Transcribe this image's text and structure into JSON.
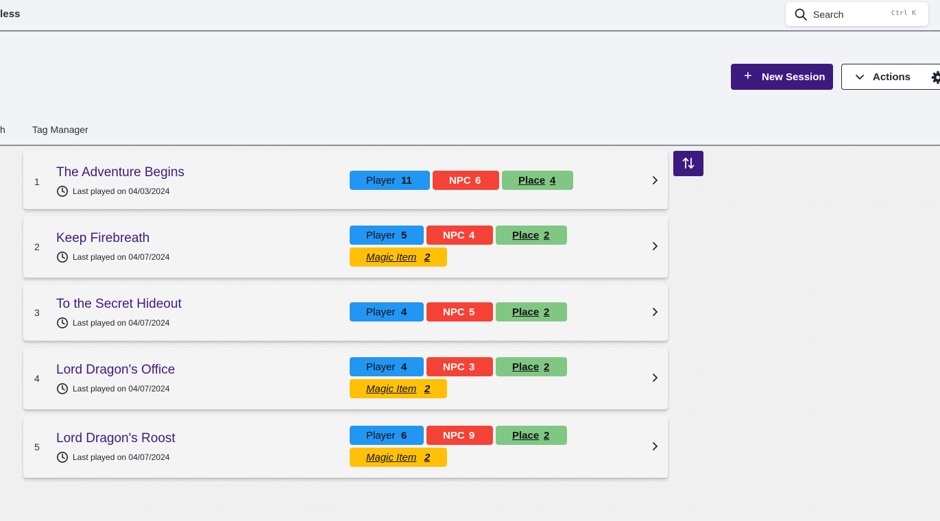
{
  "app": {
    "title_partial": "less"
  },
  "search": {
    "label": "Search",
    "shortcut": "Ctrl K",
    "icon": "search-icon"
  },
  "toolbar": {
    "new_session_label": "New Session",
    "new_session_icon": "plus-icon",
    "actions_label": "Actions",
    "actions_icon": "chevron-down-icon",
    "settings_icon": "gear-icon"
  },
  "tabs": {
    "partial_tab": "h",
    "tag_manager": "Tag Manager"
  },
  "sort_icon": "sort-arrows-icon",
  "sessions": [
    {
      "number": "1",
      "title": "The Adventure Begins",
      "last_played": "Last played on 04/03/2024",
      "tags": {
        "player": {
          "label": "Player",
          "count": "11"
        },
        "npc": {
          "label": "NPC",
          "count": "6"
        },
        "place": {
          "label": "Place",
          "count": "4"
        }
      }
    },
    {
      "number": "2",
      "title": "Keep Firebreath",
      "last_played": "Last played on 04/07/2024",
      "tags": {
        "player": {
          "label": "Player",
          "count": "5"
        },
        "npc": {
          "label": "NPC",
          "count": "4"
        },
        "place": {
          "label": "Place",
          "count": "2"
        },
        "magic": {
          "label": "Magic Item",
          "count": "2"
        }
      }
    },
    {
      "number": "3",
      "title": "To the Secret Hideout",
      "last_played": "Last played on 04/07/2024",
      "tags": {
        "player": {
          "label": "Player",
          "count": "4"
        },
        "npc": {
          "label": "NPC",
          "count": "5"
        },
        "place": {
          "label": "Place",
          "count": "2"
        }
      }
    },
    {
      "number": "4",
      "title": "Lord Dragon's Office",
      "last_played": "Last played on 04/07/2024",
      "tags": {
        "player": {
          "label": "Player",
          "count": "4"
        },
        "npc": {
          "label": "NPC",
          "count": "3"
        },
        "place": {
          "label": "Place",
          "count": "2"
        },
        "magic": {
          "label": "Magic Item",
          "count": "2"
        }
      }
    },
    {
      "number": "5",
      "title": "Lord Dragon's Roost",
      "last_played": "Last played on 04/07/2024",
      "tags": {
        "player": {
          "label": "Player",
          "count": "6"
        },
        "npc": {
          "label": "NPC",
          "count": "9"
        },
        "place": {
          "label": "Place",
          "count": "2"
        },
        "magic": {
          "label": "Magic Item",
          "count": "2"
        }
      }
    }
  ],
  "colors": {
    "accent": "#3d1a7e",
    "player": "#2196f3",
    "npc": "#f44336",
    "place": "#81c784",
    "magic_item": "#ffc107"
  }
}
